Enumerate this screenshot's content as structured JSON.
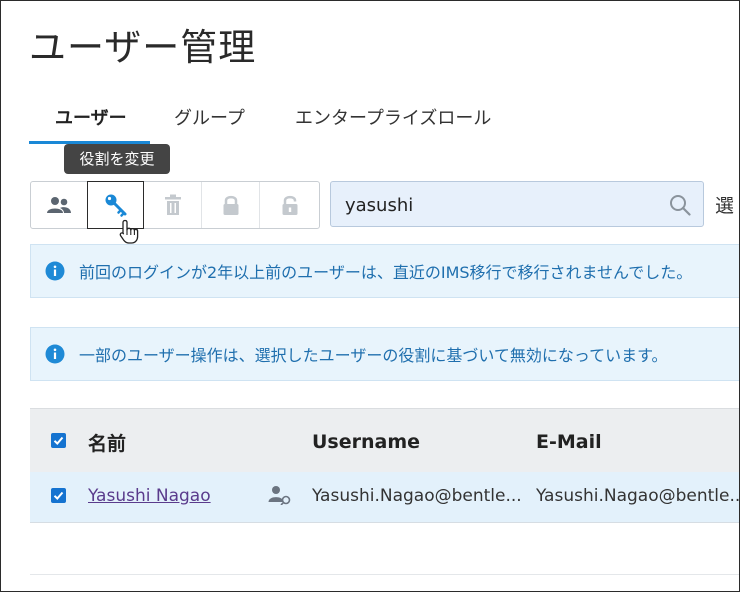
{
  "page": {
    "title": "ユーザー管理"
  },
  "tabs": [
    {
      "label": "ユーザー",
      "active": true
    },
    {
      "label": "グループ",
      "active": false
    },
    {
      "label": "エンタープライズロール",
      "active": false
    }
  ],
  "tooltip": {
    "text": "役割を変更"
  },
  "toolbar": {
    "buttons": [
      {
        "icon": "users-icon",
        "state": "enabled"
      },
      {
        "icon": "key-icon",
        "state": "hovered"
      },
      {
        "icon": "trash-icon",
        "state": "disabled"
      },
      {
        "icon": "lock-icon",
        "state": "disabled"
      },
      {
        "icon": "unlock-icon",
        "state": "disabled"
      }
    ]
  },
  "search": {
    "value": "yasushi",
    "icon": "search-icon"
  },
  "trailing_text": "選",
  "banners": [
    {
      "icon": "info-icon",
      "text": "前回のログインが2年以上前のユーザーは、直近のIMS移行で移行されませんでした。"
    },
    {
      "icon": "info-icon",
      "text": "一部のユーザー操作は、選択したユーザーの役割に基づいて無効になっています。"
    }
  ],
  "table": {
    "columns": [
      "名前",
      "Username",
      "E-Mail"
    ],
    "rows": [
      {
        "checked": true,
        "name": "Yasushi Nagao",
        "username": "Yasushi.Nagao@bentle...",
        "email": "Yasushi.Nagao@bentle..."
      }
    ]
  },
  "colors": {
    "accent": "#1a88d6",
    "checkbox": "#1573d0",
    "info": "#1f8ad6",
    "banner_bg": "#e8f4fc",
    "selected_row": "#e3f1fb"
  }
}
